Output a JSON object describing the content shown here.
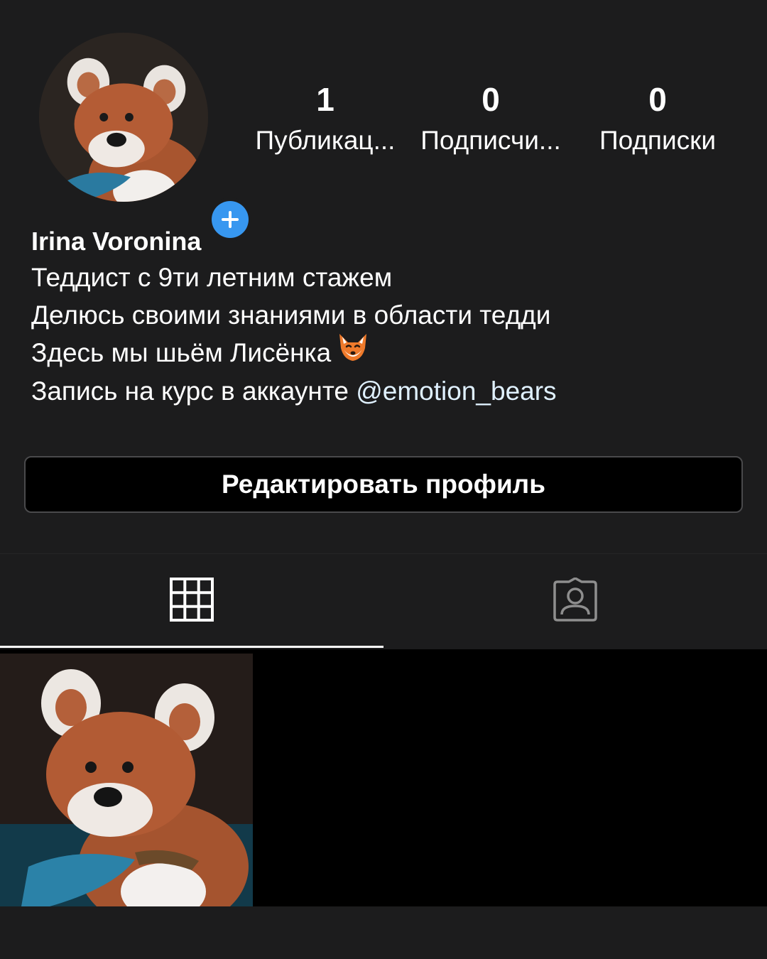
{
  "profile": {
    "avatar_alt": "profile photo",
    "name": "Irina Voronina",
    "bio_lines": [
      "Теддист с 9ти летним стажем",
      "Делюсь своими знаниями в области тедди",
      "Здесь мы шьём Лисёнка"
    ],
    "bio_course_prefix": "Запись на курс в аккаунте ",
    "bio_mention": "@emotion_bears"
  },
  "stats": {
    "posts": {
      "value": "1",
      "label": "Публикац..."
    },
    "followers": {
      "value": "0",
      "label": "Подписчи..."
    },
    "following": {
      "value": "0",
      "label": "Подписки"
    }
  },
  "actions": {
    "edit_profile_label": "Редактировать профиль"
  },
  "tabs": {
    "active": "grid",
    "items": [
      {
        "id": "grid",
        "icon": "grid-icon"
      },
      {
        "id": "tagged",
        "icon": "tagged-person-icon"
      }
    ]
  },
  "colors": {
    "background": "#1c1c1d",
    "accent": "#3797f0",
    "button_bg": "#000000",
    "button_border": "#4a4a4c",
    "text": "#ffffff"
  },
  "posts": [
    {
      "thumbnail": "teddy-fox-photo"
    }
  ]
}
